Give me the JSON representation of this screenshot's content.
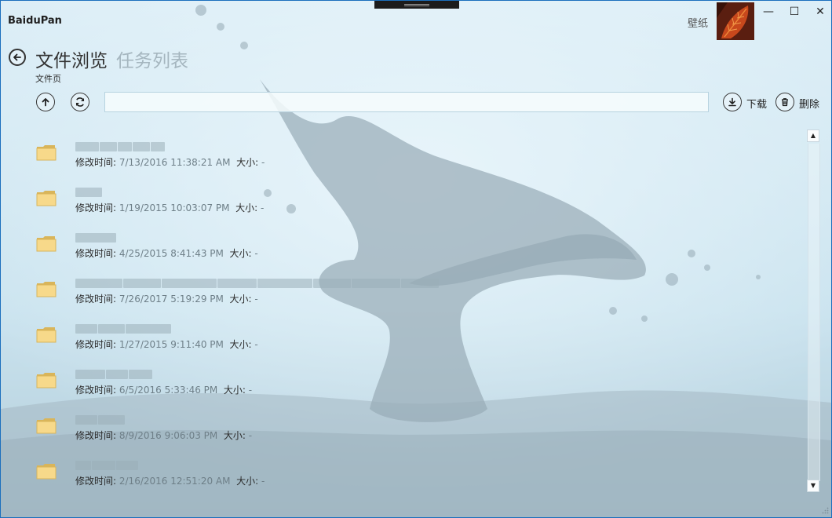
{
  "app": {
    "title": "BaiduPan",
    "wallpaper_label": "壁纸"
  },
  "window": {
    "minimize": "—",
    "maximize": "☐",
    "close": "✕"
  },
  "nav": {
    "tab_files": "文件浏览",
    "tab_tasks": "任务列表",
    "subtitle": "文件页"
  },
  "toolbar": {
    "path_value": "",
    "download_label": "下载",
    "delete_label": "删除"
  },
  "labels": {
    "modified": "修改时间:",
    "size": "大小:"
  },
  "files": [
    {
      "modified": "7/13/2016 11:38:21 AM",
      "size": "-"
    },
    {
      "modified": "1/19/2015 10:03:07 PM",
      "size": "-"
    },
    {
      "modified": "4/25/2015 8:41:43 PM",
      "size": "-"
    },
    {
      "modified": "7/26/2017 5:19:29 PM",
      "size": "-"
    },
    {
      "modified": "1/27/2015 9:11:40 PM",
      "size": "-"
    },
    {
      "modified": "6/5/2016 5:33:46 PM",
      "size": "-"
    },
    {
      "modified": "8/9/2016 9:06:03 PM",
      "size": "-"
    },
    {
      "modified": "2/16/2016 12:51:20 AM",
      "size": "-"
    }
  ],
  "colors": {
    "accent": "#1b6fbd",
    "folder": "#f7d98a",
    "folder_edge": "#d9b55a",
    "muted": "#6e7f88"
  }
}
